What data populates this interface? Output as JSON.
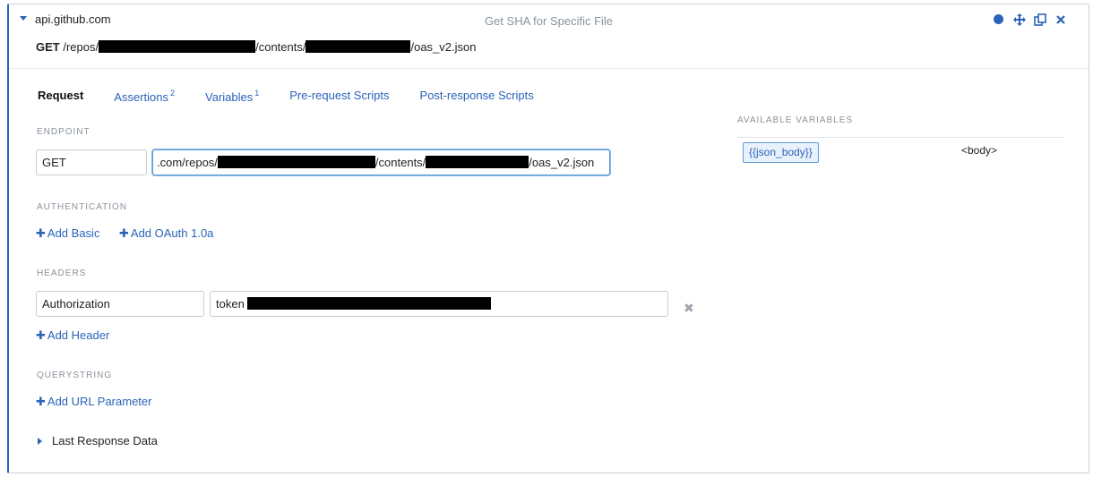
{
  "header": {
    "host": "api.github.com",
    "title": "Get SHA for Specific File",
    "method": "GET",
    "path_part1": "/repos/",
    "path_part2": "/contents/",
    "path_part3": "/oas_v2.json"
  },
  "tools": {
    "status_icon": "circle-icon",
    "move_icon": "move-icon",
    "duplicate_icon": "duplicate-icon",
    "close_icon": "close-icon",
    "accent": "#2a63b8"
  },
  "tabs": [
    {
      "label": "Request",
      "badge": ""
    },
    {
      "label": "Assertions",
      "badge": "2"
    },
    {
      "label": "Variables",
      "badge": "1"
    },
    {
      "label": "Pre-request Scripts",
      "badge": ""
    },
    {
      "label": "Post-response Scripts",
      "badge": ""
    }
  ],
  "endpoint": {
    "label": "ENDPOINT",
    "method": "GET",
    "url_prefix": ".com/repos/",
    "url_mid": "/contents/",
    "url_suffix": "/oas_v2.json"
  },
  "authentication": {
    "label": "AUTHENTICATION",
    "add_basic": "Add Basic",
    "add_oauth": "Add OAuth 1.0a"
  },
  "headers": {
    "label": "HEADERS",
    "name": "Authorization",
    "value_prefix": "token",
    "add_header": "Add Header"
  },
  "querystring": {
    "label": "QUERYSTRING",
    "add_param": "Add URL Parameter"
  },
  "last_response": {
    "label": "Last Response Data"
  },
  "variables_panel": {
    "label": "AVAILABLE VARIABLES",
    "name": "{{json_body}}",
    "value": "<body>"
  }
}
